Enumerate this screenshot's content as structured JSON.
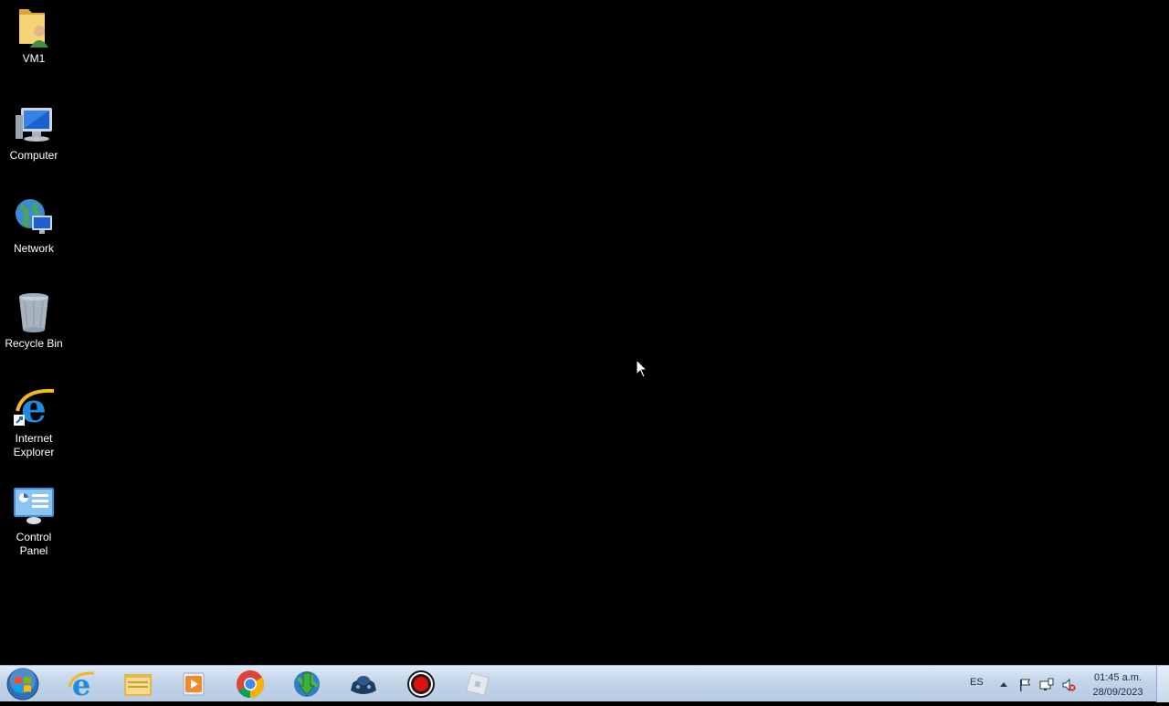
{
  "desktop": {
    "icons": [
      {
        "label": "VM1",
        "icon": "user-folder-icon"
      },
      {
        "label": "Computer",
        "icon": "computer-icon"
      },
      {
        "label": "Network",
        "icon": "network-icon"
      },
      {
        "label": "Recycle Bin",
        "icon": "recycle-bin-icon"
      },
      {
        "label": "Internet\nExplorer",
        "icon": "internet-explorer-icon"
      },
      {
        "label": "Control\nPanel",
        "icon": "control-panel-icon"
      }
    ]
  },
  "taskbar": {
    "pinned": [
      {
        "name": "internet-explorer",
        "icon": "internet-explorer-icon"
      },
      {
        "name": "windows-explorer",
        "icon": "folder-icon"
      },
      {
        "name": "media-player",
        "icon": "media-player-icon"
      },
      {
        "name": "chrome",
        "icon": "chrome-icon"
      },
      {
        "name": "download-manager",
        "icon": "globe-download-icon"
      },
      {
        "name": "game-app",
        "icon": "game-controller-icon"
      },
      {
        "name": "screen-recorder",
        "icon": "record-icon"
      },
      {
        "name": "roblox",
        "icon": "roblox-icon"
      }
    ],
    "tray": {
      "language": "ES",
      "time": "01:45 a.m.",
      "date": "28/09/2023"
    }
  }
}
